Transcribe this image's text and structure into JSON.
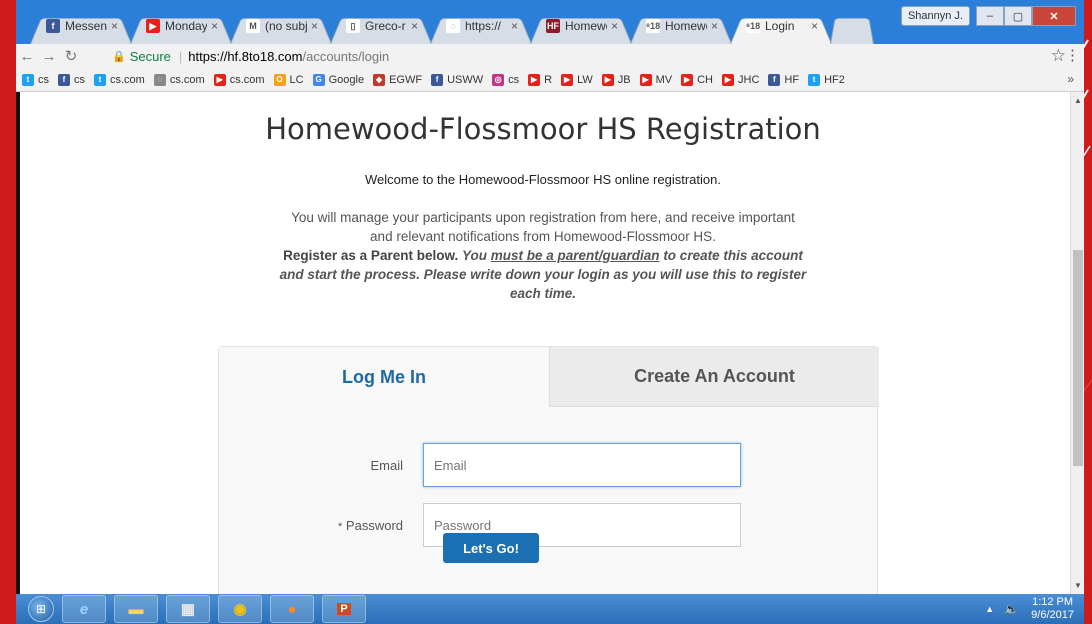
{
  "browser": {
    "tabs": [
      {
        "label": "Messeng",
        "icon": "facebook-icon",
        "color": "#3b5998",
        "glyph": "f"
      },
      {
        "label": "Monday",
        "icon": "youtube-icon",
        "color": "#e62117",
        "glyph": "▶"
      },
      {
        "label": "(no subj",
        "icon": "gmail-icon",
        "color": "#ffffff",
        "glyph": "M"
      },
      {
        "label": "Greco-r",
        "icon": "document-icon",
        "color": "#ffffff",
        "glyph": "▯"
      },
      {
        "label": "https://",
        "icon": "globe-icon",
        "color": "#ffffff",
        "glyph": "◌"
      },
      {
        "label": "Homewo",
        "icon": "hf-icon",
        "color": "#8b1c2b",
        "glyph": "HF"
      },
      {
        "label": "Homewo",
        "icon": "8to18-icon",
        "color": "#ffffff",
        "glyph": "⁸18"
      },
      {
        "label": "Login",
        "icon": "8to18-icon",
        "color": "#ffffff",
        "glyph": "⁸18",
        "active": true
      }
    ],
    "user_name": "Shannyn J.",
    "secure_label": "Secure",
    "url_host": "https://hf.8to18.com",
    "url_path": "/accounts/login",
    "bookmarks": [
      {
        "label": "cs",
        "icon": "twitter-icon",
        "color": "#1da1f2",
        "glyph": "t"
      },
      {
        "label": "cs",
        "icon": "facebook-icon",
        "color": "#3b5998",
        "glyph": "f"
      },
      {
        "label": "cs.com",
        "icon": "twitter-icon",
        "color": "#1da1f2",
        "glyph": "t"
      },
      {
        "label": "cs.com",
        "icon": "globe-icon",
        "color": "#888888",
        "glyph": "◌"
      },
      {
        "label": "cs.com",
        "icon": "youtube-icon",
        "color": "#e62117",
        "glyph": "▶"
      },
      {
        "label": "LC",
        "icon": "o-icon",
        "color": "#f4a020",
        "glyph": "O"
      },
      {
        "label": "Google",
        "icon": "google-icon",
        "color": "#4285f4",
        "glyph": "G"
      },
      {
        "label": "EGWF",
        "icon": "egwf-icon",
        "color": "#c0392b",
        "glyph": "◆"
      },
      {
        "label": "USWW",
        "icon": "facebook-icon",
        "color": "#3b5998",
        "glyph": "f"
      },
      {
        "label": "cs",
        "icon": "instagram-icon",
        "color": "#c13584",
        "glyph": "◎"
      },
      {
        "label": "R",
        "icon": "youtube-icon",
        "color": "#e62117",
        "glyph": "▶"
      },
      {
        "label": "LW",
        "icon": "youtube-icon",
        "color": "#e62117",
        "glyph": "▶"
      },
      {
        "label": "JB",
        "icon": "youtube-icon",
        "color": "#e62117",
        "glyph": "▶"
      },
      {
        "label": "MV",
        "icon": "youtube-icon",
        "color": "#e62117",
        "glyph": "▶"
      },
      {
        "label": "CH",
        "icon": "youtube-icon",
        "color": "#e62117",
        "glyph": "▶"
      },
      {
        "label": "JHC",
        "icon": "youtube-icon",
        "color": "#e62117",
        "glyph": "▶"
      },
      {
        "label": "HF",
        "icon": "facebook-icon",
        "color": "#3b5998",
        "glyph": "f"
      },
      {
        "label": "HF2",
        "icon": "twitter-icon",
        "color": "#1da1f2",
        "glyph": "t"
      }
    ]
  },
  "page": {
    "title": "Homewood-Flossmoor HS Registration",
    "welcome": "Welcome to the Homewood-Flossmoor HS online registration.",
    "intro_1": "You will manage your participants upon registration from here, and receive important and relevant notifications from Homewood-Flossmoor HS.",
    "intro_strong": "Register as a Parent below.",
    "intro_em_1": "You",
    "intro_em_u": "must be a parent/guardian",
    "intro_em_2": "to create this account and start the process. Please write down your login as you will use this to register each time.",
    "tab_login": "Log Me In",
    "tab_create": "Create An Account",
    "email_label": "Email",
    "email_placeholder": "Email",
    "password_req": "*",
    "password_label": "Password",
    "password_placeholder": "Password",
    "submit_label": "Let's Go!"
  },
  "taskbar": {
    "time": "1:12 PM",
    "date": "9/6/2017"
  },
  "colors": {
    "accent": "#1a70b3",
    "link": "#1f6aa5",
    "slide_red": "#cf1b1b"
  }
}
